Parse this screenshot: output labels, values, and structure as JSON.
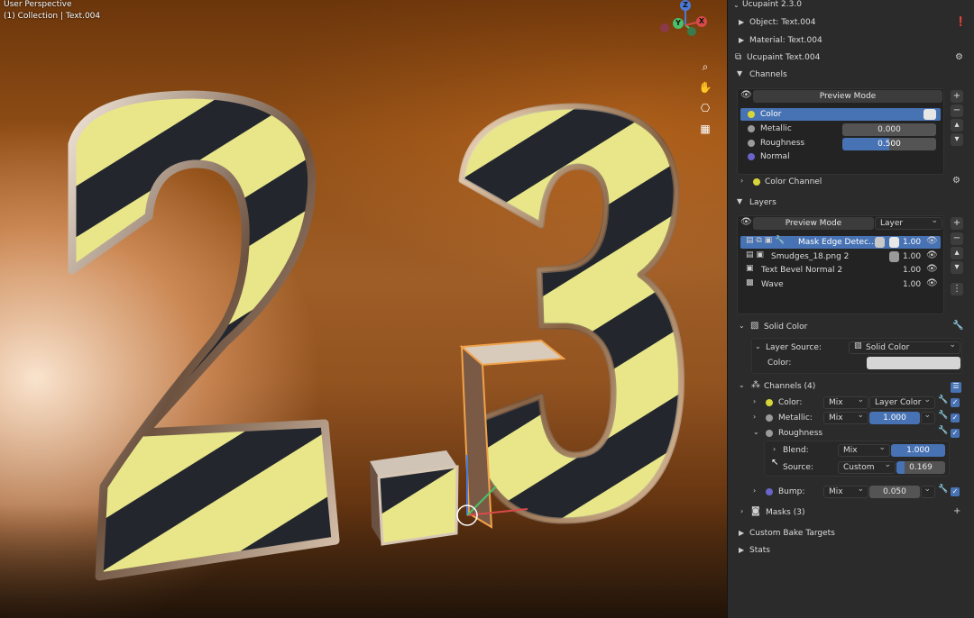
{
  "viewport": {
    "perspective_label": "User Perspective",
    "collection_label": "(1) Collection | Text.004",
    "big_text_left": "2.",
    "big_text_right": "3",
    "gizmo": {
      "z": "Z",
      "y": "Y",
      "x": "X"
    },
    "nav_icons": [
      "zoom-icon",
      "hand-pan-icon",
      "camera-icon",
      "grid-view-icon"
    ]
  },
  "panel": {
    "title": "Ucupaint 2.3.0",
    "object_label": "Object: Text.004",
    "material_label": "Material: Text.004",
    "ucupaint_label": "Ucupaint Text.004",
    "channels_header": "Channels",
    "channels_preview_mode": "Preview Mode",
    "channels": [
      {
        "name": "Color",
        "value": "",
        "dot": "#d6d63a"
      },
      {
        "name": "Metallic",
        "value": "0.000",
        "dot": "#9a9a9a"
      },
      {
        "name": "Roughness",
        "value": "0.500",
        "dot": "#9a9a9a"
      },
      {
        "name": "Normal",
        "value": "",
        "dot": "#6a64c8"
      }
    ],
    "color_channel_label": "Color Channel",
    "layers_header": "Layers",
    "layers_preview_mode": "Preview Mode",
    "layers_dropdown": "Layer",
    "layers": [
      {
        "name": "Mask Edge Detec...",
        "value": "1.00"
      },
      {
        "name": "Smudges_18.png 2",
        "value": "1.00"
      },
      {
        "name": "Text Bevel Normal 2",
        "value": "1.00"
      },
      {
        "name": "Wave",
        "value": "1.00"
      }
    ],
    "solid_color_header": "Solid Color",
    "layer_source_label": "Layer Source:",
    "layer_source_value": "Solid Color",
    "color_label": "Color:",
    "channels_count_header": "Channels (4)",
    "layer_channels": {
      "color_label": "Color:",
      "color_blend": "Mix",
      "color_source": "Layer Color",
      "metallic_label": "Metallic:",
      "metallic_blend": "Mix",
      "metallic_value": "1.000",
      "roughness_label": "Roughness",
      "blend_label": "Blend:",
      "blend_mode": "Mix",
      "blend_value": "1.000",
      "source_label": "Source:",
      "source_mode": "Custom",
      "source_value": "0.169",
      "bump_label": "Bump:",
      "bump_blend": "Mix",
      "bump_value": "0.050"
    },
    "masks_header": "Masks (3)",
    "custom_bake_label": "Custom Bake Targets",
    "stats_label": "Stats"
  },
  "colors": {
    "accent_blue": "#4772b3",
    "panel_bg": "#2b2b2b",
    "stripe_yellow": "#e9e68a",
    "stripe_dark": "#23272d"
  }
}
